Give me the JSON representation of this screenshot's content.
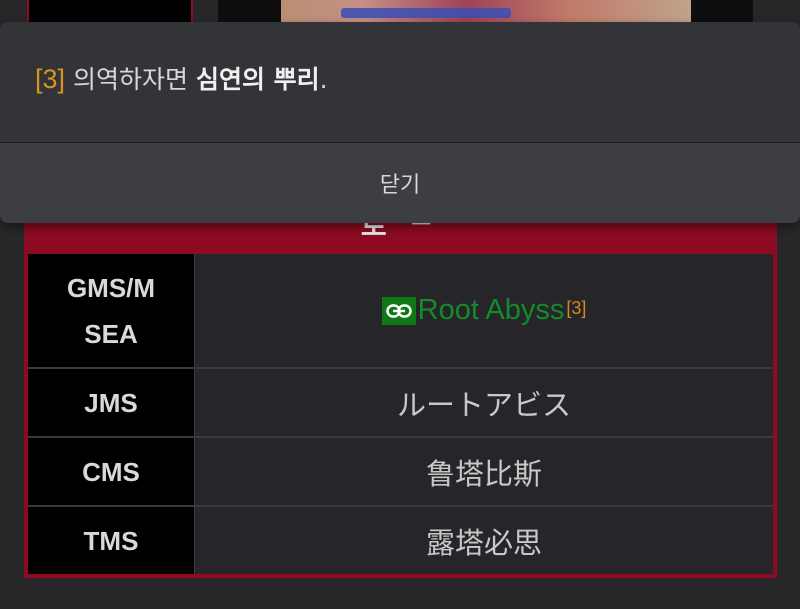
{
  "popup": {
    "footnote_ref": "[3]",
    "text_before": " 의역하자면 ",
    "text_bold": "심연의 뿌리",
    "text_after": ".",
    "close_label": "닫기"
  },
  "infobox": {
    "header_partial": "로 ᄃ",
    "rows": [
      {
        "label": "GMS/M SEA",
        "value": "Root Abyss",
        "footnote": "[3]",
        "is_link": true
      },
      {
        "label": "JMS",
        "value": "ルートアビス"
      },
      {
        "label": "CMS",
        "value": "鲁塔比斯"
      },
      {
        "label": "TMS",
        "value": "露塔必思"
      }
    ]
  },
  "colors": {
    "accent_red": "#8c0b22",
    "link_green": "#158a2a",
    "footnote_orange": "#d7931e"
  },
  "icons": {
    "link": "link-icon"
  }
}
